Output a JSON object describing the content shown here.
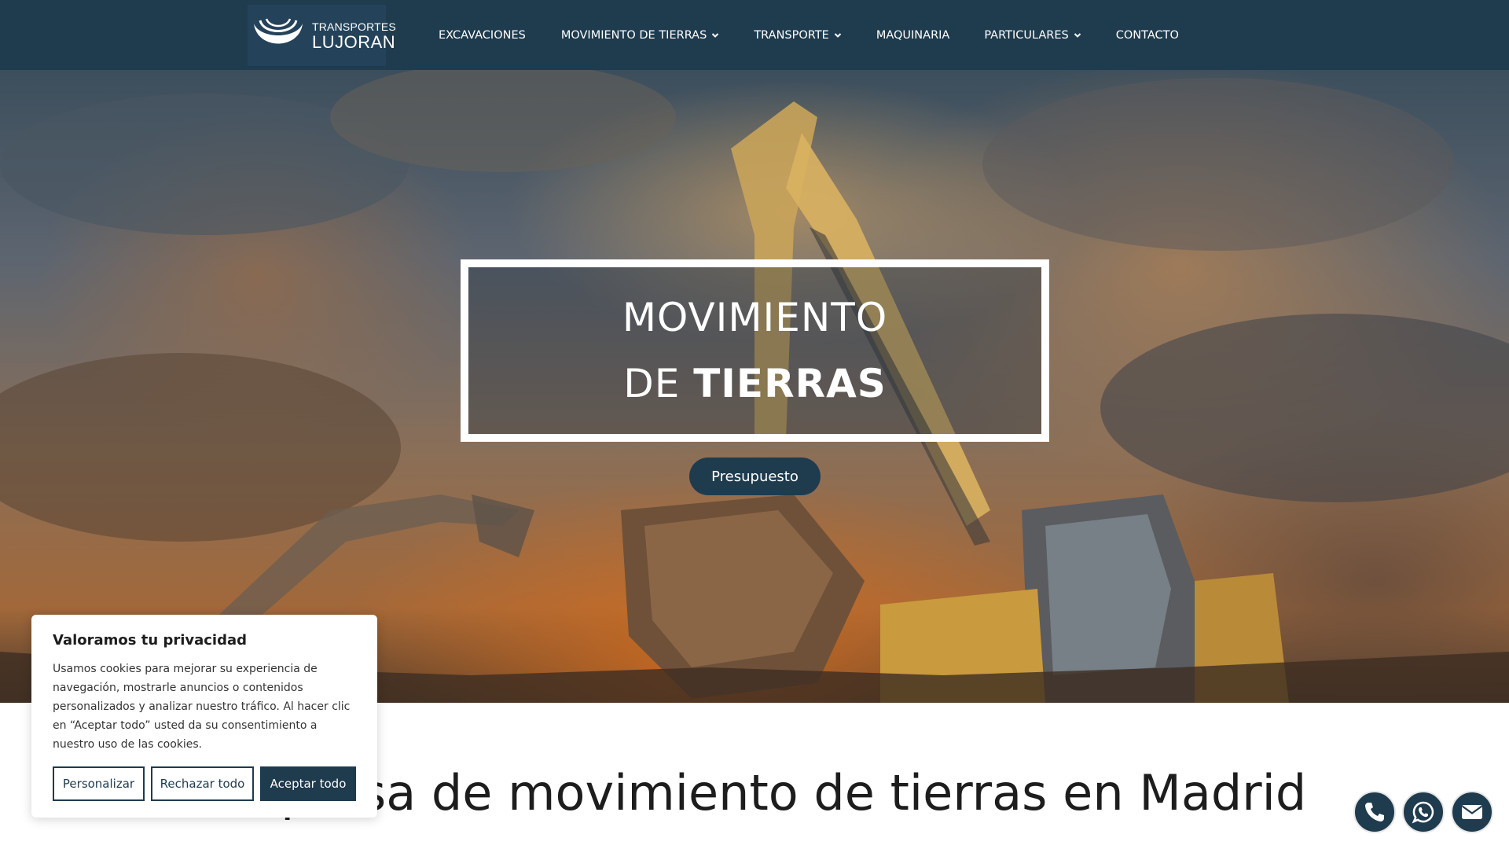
{
  "header": {
    "logo": {
      "line1": "TRANSPORTES",
      "line2": "LUJORAN"
    },
    "nav": [
      {
        "label": "EXCAVACIONES",
        "has_dropdown": false
      },
      {
        "label": "MOVIMIENTO DE TIERRAS",
        "has_dropdown": true
      },
      {
        "label": "TRANSPORTE",
        "has_dropdown": true
      },
      {
        "label": "MAQUINARIA",
        "has_dropdown": false
      },
      {
        "label": "PARTICULARES",
        "has_dropdown": true
      },
      {
        "label": "CONTACTO",
        "has_dropdown": false
      }
    ]
  },
  "hero": {
    "line1": "MOVIMIENTO",
    "line2_regular": "DE ",
    "line2_bold": "TIERRAS",
    "cta_label": "Presupuesto"
  },
  "main": {
    "title": "Empresa de movimiento de tierras en Madrid"
  },
  "cookie": {
    "title": "Valoramos tu privacidad",
    "text": "Usamos cookies para mejorar su experiencia de navegación, mostrarle anuncios o contenidos personalizados y analizar nuestro tráfico. Al hacer clic en “Aceptar todo” usted da su consentimiento a nuestro uso de las cookies.",
    "customize_label": "Personalizar",
    "reject_label": "Rechazar todo",
    "accept_label": "Aceptar todo"
  },
  "floating": {
    "icons": [
      "phone-icon",
      "whatsapp-icon",
      "mail-icon"
    ]
  },
  "colors": {
    "brand": "#1f3b4e",
    "white": "#ffffff"
  }
}
